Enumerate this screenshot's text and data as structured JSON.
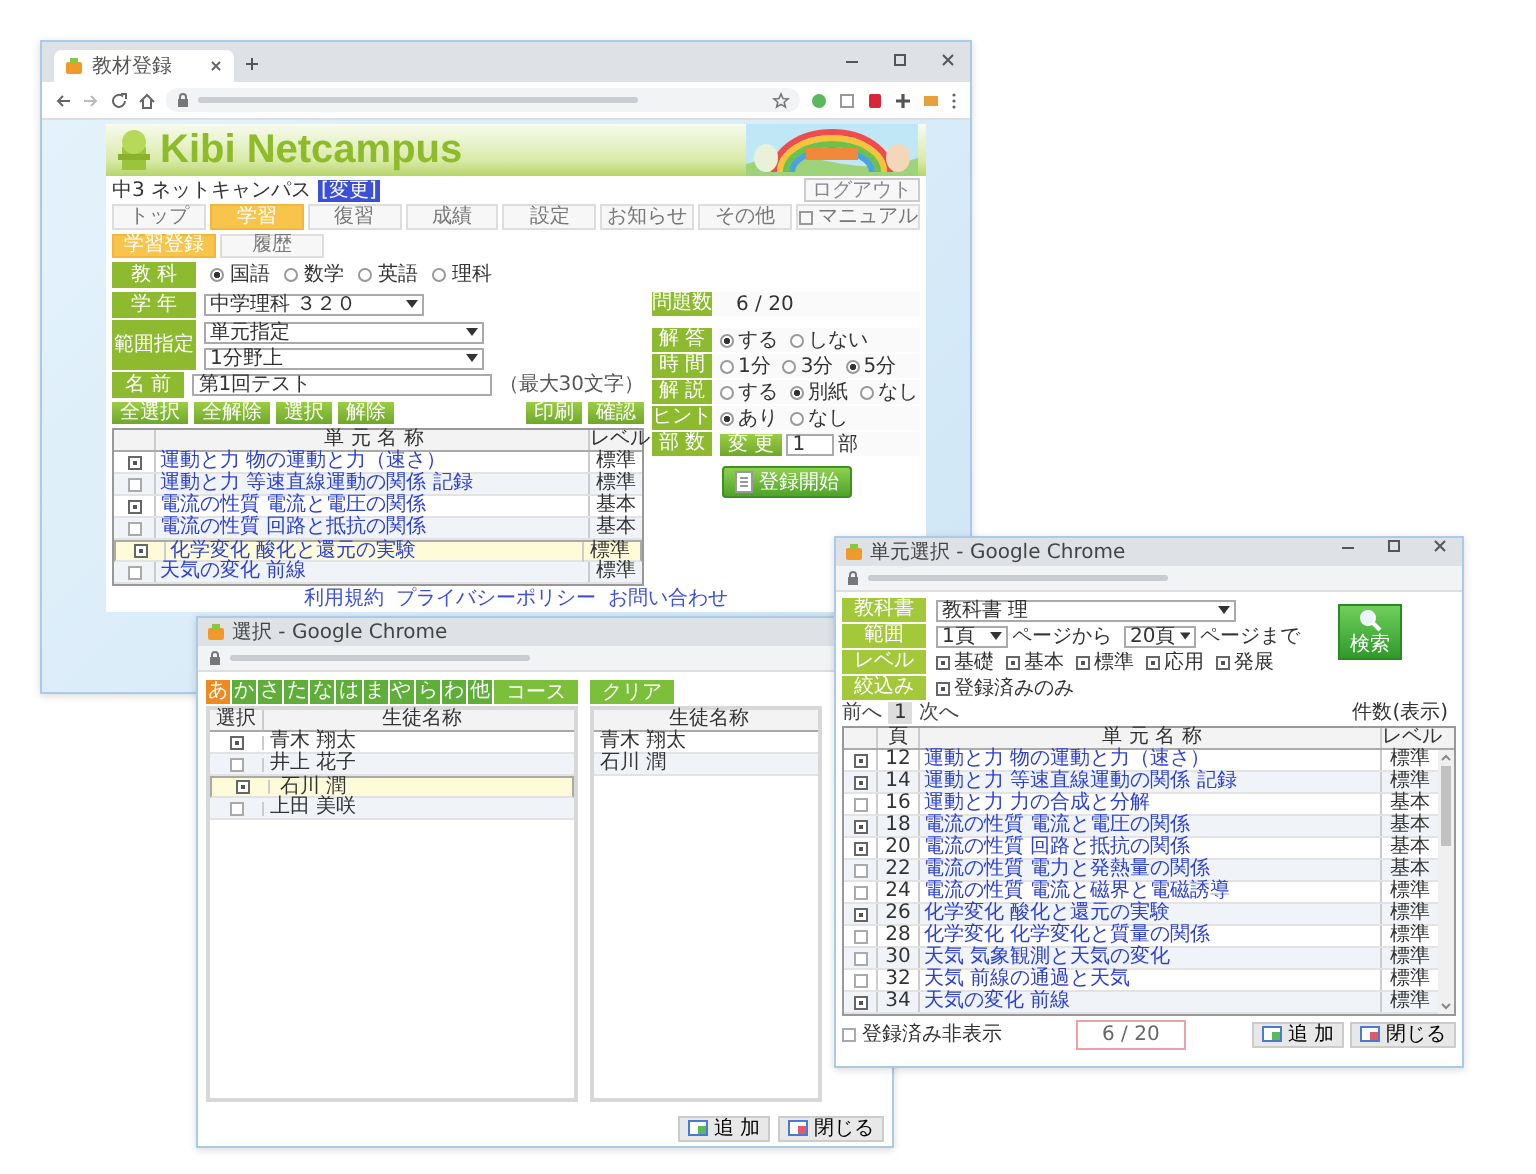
{
  "main_window": {
    "tab_title": "教材登録",
    "logo": "Kibi Netcampus",
    "user_name": "中3 ネットキャンパス",
    "user_tag": "[変更]",
    "logout_button": "ログアウト",
    "menu": [
      {
        "label": "トップ",
        "selected": false
      },
      {
        "label": "学習",
        "selected": true
      },
      {
        "label": "復習",
        "selected": false
      },
      {
        "label": "成績",
        "selected": false
      },
      {
        "label": "設定",
        "selected": false
      },
      {
        "label": "お知らせ",
        "selected": false
      },
      {
        "label": "その他",
        "selected": false
      }
    ],
    "manual_button": "マニュアル",
    "subtabs": [
      {
        "label": "学習登録",
        "selected": true
      },
      {
        "label": "履歴",
        "selected": false
      }
    ],
    "subject": {
      "label": "教 科",
      "options": [
        {
          "label": "国語",
          "selected": true
        },
        {
          "label": "数学",
          "selected": false
        },
        {
          "label": "英語",
          "selected": false
        },
        {
          "label": "理科",
          "selected": false
        }
      ]
    },
    "fields": [
      {
        "label": "学 年",
        "inputs": [
          {
            "kind": "select",
            "value": "中学理科 ３２０"
          }
        ]
      },
      {
        "label": "範囲指定",
        "inputs": [
          {
            "kind": "select",
            "value": "単元指定"
          },
          {
            "kind": "select",
            "value": "1分野上"
          }
        ]
      },
      {
        "label": "名 前",
        "inputs": [
          {
            "kind": "text",
            "value": "第1回テスト"
          }
        ],
        "note": "（最大30文字）"
      }
    ],
    "buttons_left": [
      "全選択",
      "全解除",
      "選択",
      "解除"
    ],
    "buttons_right": [
      "印刷",
      "確認"
    ],
    "table": {
      "columns": [
        "単 元 名 称",
        "レベル"
      ],
      "rows": [
        {
          "checked": true,
          "selected": false,
          "title": "運動と力 物の運動と力（速さ）",
          "level": "標準"
        },
        {
          "checked": false,
          "selected": false,
          "title": "運動と力 等速直線運動の関係 記録",
          "level": "標準"
        },
        {
          "checked": true,
          "selected": false,
          "title": "電流の性質 電流と電圧の関係",
          "level": "基本"
        },
        {
          "checked": false,
          "selected": false,
          "title": "電流の性質 回路と抵抗の関係",
          "level": "基本"
        },
        {
          "checked": true,
          "selected": true,
          "title": "化学変化 酸化と還元の実験",
          "level": "標準"
        },
        {
          "checked": false,
          "selected": false,
          "title": "天気の変化 前線",
          "level": "標準"
        }
      ]
    },
    "settings": {
      "count_label": "問題数",
      "count": "6 / 20",
      "rows": [
        {
          "label": "解 答",
          "options": [
            {
              "label": "する",
              "selected": true
            },
            {
              "label": "しない",
              "selected": false
            }
          ]
        },
        {
          "label": "時 間",
          "options": [
            {
              "label": "1分",
              "selected": false
            },
            {
              "label": "3分",
              "selected": false
            },
            {
              "label": "5分",
              "selected": true
            }
          ]
        },
        {
          "label": "解 説",
          "options": [
            {
              "label": "する",
              "selected": false
            },
            {
              "label": "別紙",
              "selected": true
            },
            {
              "label": "なし",
              "selected": false
            }
          ]
        },
        {
          "label": "ヒント",
          "options": [
            {
              "label": "あり",
              "selected": true
            },
            {
              "label": "なし",
              "selected": false
            }
          ]
        }
      ],
      "copies": {
        "label": "部 数",
        "button": "変 更",
        "value": "1",
        "unit": "部"
      }
    },
    "start_button": "登録開始",
    "footer_links": [
      "利用規約",
      "プライバシーポリシー",
      "お問い合わせ"
    ]
  },
  "student_window": {
    "title": "選択 - Google Chrome",
    "kana_tabs": [
      {
        "label": "あ",
        "selected": true
      },
      {
        "label": "か",
        "selected": false
      },
      {
        "label": "さ",
        "selected": false
      },
      {
        "label": "た",
        "selected": false
      },
      {
        "label": "な",
        "selected": false
      },
      {
        "label": "は",
        "selected": false
      },
      {
        "label": "ま",
        "selected": false
      },
      {
        "label": "や",
        "selected": false
      },
      {
        "label": "ら",
        "selected": false
      },
      {
        "label": "わ",
        "selected": false
      },
      {
        "label": "他",
        "selected": false
      }
    ],
    "course_button": "コース",
    "clear_button": "クリア",
    "left_columns": [
      "選択",
      "生徒名称"
    ],
    "left_rows": [
      {
        "name": "青木 翔太",
        "checked": true,
        "selected": false
      },
      {
        "name": "井上 花子",
        "checked": false,
        "selected": false
      },
      {
        "name": "石川 潤",
        "checked": true,
        "selected": true
      },
      {
        "name": "上田 美咲",
        "checked": false,
        "selected": false
      }
    ],
    "right_column": "生徒名称",
    "right_rows": [
      "青木 翔太",
      "石川 潤"
    ],
    "buttons": [
      "追 加",
      "閉じる"
    ]
  },
  "unit_window": {
    "title": "単元選択 - Google Chrome",
    "filters": [
      {
        "label": "教科書",
        "kind": "select",
        "value": "教科書 理"
      },
      {
        "label": "範囲",
        "kind": "range",
        "from": "1頁",
        "from_note": "ページから",
        "to": "20頁",
        "to_note": "ページまで"
      },
      {
        "label": "レベル",
        "kind": "checks",
        "options": [
          {
            "label": "基礎",
            "checked": true
          },
          {
            "label": "基本",
            "checked": true
          },
          {
            "label": "標準",
            "checked": true
          },
          {
            "label": "応用",
            "checked": true
          },
          {
            "label": "発展",
            "checked": true
          }
        ]
      },
      {
        "label": "絞込み",
        "kind": "checks",
        "options": [
          {
            "label": "登録済みのみ",
            "checked": true
          }
        ]
      }
    ],
    "search_button": "検索",
    "pager": {
      "prev": "前へ",
      "page": "1",
      "next": "次へ"
    },
    "count_label": "件数(表示)",
    "columns": [
      "頁",
      "単 元 名 称",
      "レベル"
    ],
    "rows": [
      {
        "page": "12",
        "title": "運動と力 物の運動と力（速さ）",
        "level": "標準",
        "checked": true
      },
      {
        "page": "14",
        "title": "運動と力 等速直線運動の関係 記録",
        "level": "標準",
        "checked": true
      },
      {
        "page": "16",
        "title": "運動と力 力の合成と分解",
        "level": "基本",
        "checked": false
      },
      {
        "page": "18",
        "title": "電流の性質 電流と電圧の関係",
        "level": "基本",
        "checked": true
      },
      {
        "page": "20",
        "title": "電流の性質 回路と抵抗の関係",
        "level": "基本",
        "checked": true
      },
      {
        "page": "22",
        "title": "電流の性質 電力と発熱量の関係",
        "level": "基本",
        "checked": false
      },
      {
        "page": "24",
        "title": "電流の性質 電流と磁界と電磁誘導",
        "level": "標準",
        "checked": false
      },
      {
        "page": "26",
        "title": "化学変化 酸化と還元の実験",
        "level": "標準",
        "checked": true
      },
      {
        "page": "28",
        "title": "化学変化 化学変化と質量の関係",
        "level": "標準",
        "checked": false
      },
      {
        "page": "30",
        "title": "天気 気象観測と天気の変化",
        "level": "標準",
        "checked": false
      },
      {
        "page": "32",
        "title": "天気 前線の通過と天気",
        "level": "標準",
        "checked": false
      },
      {
        "page": "34",
        "title": "天気の変化 前線",
        "level": "標準",
        "checked": true
      }
    ],
    "hide_registered": {
      "label": "登録済み非表示",
      "checked": false
    },
    "counter": "6 / 20",
    "buttons": [
      "追 加",
      "閉じる"
    ]
  }
}
